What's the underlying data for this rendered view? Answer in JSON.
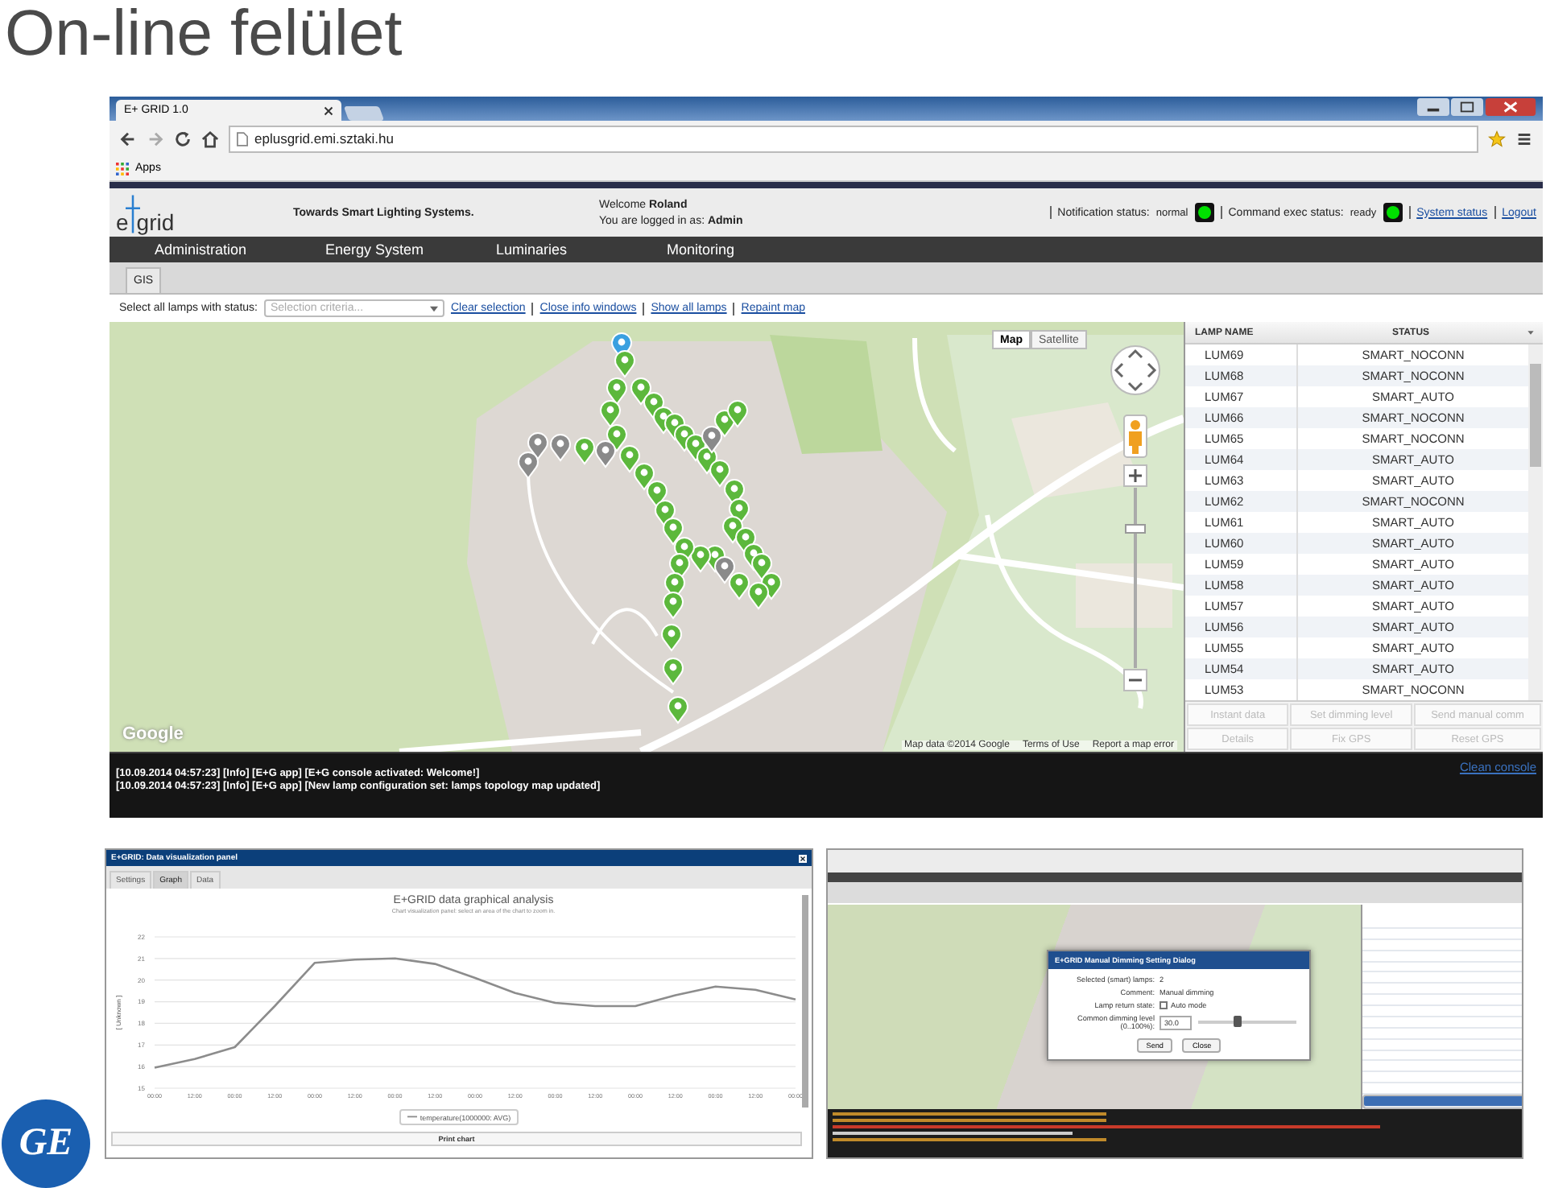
{
  "slide": {
    "title": "On-line felület"
  },
  "browser": {
    "tab": "E+ GRID 1.0",
    "url": "eplusgrid.emi.sztaki.hu",
    "bookmark": "Apps"
  },
  "app": {
    "logo": {
      "left": "e",
      "right": "grid"
    },
    "tagline": "Towards Smart Lighting Systems.",
    "welcome": "Welcome **Roland**",
    "login": "You are logged in as: **Admin**",
    "statuses": [
      {
        "label": "Notification status:",
        "value": "normal",
        "color": "#00e000"
      },
      {
        "label": "Command exec status:",
        "value": "ready",
        "color": "#00e000"
      }
    ],
    "links": [
      "System status",
      "Logout"
    ],
    "menu": [
      "Administration",
      "Energy System",
      "Luminaries",
      "Monitoring"
    ],
    "tabs": [
      {
        "label": "GIS",
        "selected": true
      }
    ],
    "filter": {
      "label": "Select all lamps with status:",
      "placeholder": "Selection criteria...",
      "links": [
        "Clear selection",
        "Close info windows",
        "Show all lamps",
        "Repaint map"
      ]
    },
    "map": {
      "types": [
        {
          "label": "Map",
          "selected": true
        },
        {
          "label": "Satellite",
          "selected": false
        }
      ],
      "logo": "Google",
      "footer": [
        "Map data ©2014 Google",
        "Terms of Use",
        "Report a map error"
      ]
    },
    "table": {
      "columns": [
        "LAMP NAME",
        "STATUS"
      ],
      "rows": [
        {
          "name": "LUM69",
          "status": "SMART_NOCONN"
        },
        {
          "name": "LUM68",
          "status": "SMART_NOCONN"
        },
        {
          "name": "LUM67",
          "status": "SMART_AUTO"
        },
        {
          "name": "LUM66",
          "status": "SMART_NOCONN"
        },
        {
          "name": "LUM65",
          "status": "SMART_NOCONN"
        },
        {
          "name": "LUM64",
          "status": "SMART_AUTO"
        },
        {
          "name": "LUM63",
          "status": "SMART_AUTO"
        },
        {
          "name": "LUM62",
          "status": "SMART_NOCONN"
        },
        {
          "name": "LUM61",
          "status": "SMART_AUTO"
        },
        {
          "name": "LUM60",
          "status": "SMART_AUTO"
        },
        {
          "name": "LUM59",
          "status": "SMART_AUTO"
        },
        {
          "name": "LUM58",
          "status": "SMART_AUTO"
        },
        {
          "name": "LUM57",
          "status": "SMART_AUTO"
        },
        {
          "name": "LUM56",
          "status": "SMART_AUTO"
        },
        {
          "name": "LUM55",
          "status": "SMART_AUTO"
        },
        {
          "name": "LUM54",
          "status": "SMART_AUTO"
        },
        {
          "name": "LUM53",
          "status": "SMART_NOCONN"
        }
      ],
      "buttons": [
        {
          "label": "Instant data",
          "disabled": true
        },
        {
          "label": "Set dimming level",
          "disabled": true
        },
        {
          "label": "Send manual comm",
          "disabled": true
        },
        {
          "label": "Details",
          "disabled": true
        },
        {
          "label": "Fix GPS",
          "disabled": true
        },
        {
          "label": "Reset GPS",
          "disabled": true
        }
      ]
    },
    "console": {
      "link": "Clean console",
      "lines": [
        "[10.09.2014 04:57:23] [Info] [E+G app] [E+G console activated: Welcome!]",
        "[10.09.2014 04:57:23] [Info] [E+G app] [New lamp configuration set: lamps topology map updated]"
      ]
    }
  },
  "chart_panel": {
    "title": "E+GRID: Data visualization panel",
    "tabs": [
      {
        "label": "Settings",
        "selected": false
      },
      {
        "label": "Graph",
        "selected": true
      },
      {
        "label": "Data",
        "selected": false
      }
    ],
    "subtitle": "Chart visualization panel: select an area of the chart to zoom in.",
    "button": "Print chart",
    "chart_data": {
      "type": "line",
      "title": "E+GRID data graphical analysis",
      "ylabel": "[ Unknown ]",
      "categories": [
        "00:00",
        "12:00",
        "00:00",
        "12:00",
        "00:00",
        "12:00",
        "00:00",
        "12:00",
        "00:00",
        "12:00",
        "00:00",
        "12:00",
        "00:00",
        "12:00",
        "00:00",
        "12:00",
        "00:00"
      ],
      "series": [
        {
          "name": "temperature(1000000: AVG)",
          "color": "#8c8c8c",
          "values": [
            15.95,
            16.35,
            16.9,
            18.8,
            20.8,
            20.95,
            21.0,
            20.75,
            20.1,
            19.4,
            18.95,
            18.8,
            18.8,
            19.3,
            19.7,
            19.55,
            19.1
          ]
        }
      ],
      "ylim": [
        15,
        22
      ],
      "grid": true,
      "yticks": [
        15,
        16,
        17,
        18,
        19,
        20,
        21,
        22
      ]
    }
  },
  "dialog_shot": {
    "title": "E+GRID Manual Dimming Setting Dialog",
    "fields": [
      {
        "label": "Selected (smart) lamps:",
        "value": "2"
      },
      {
        "label": "Comment:",
        "value": "Manual dimming"
      }
    ],
    "checkbox": {
      "label": "Lamp return state:",
      "text": "Auto mode",
      "checked": false
    },
    "slider": {
      "label": "Common dimming level (0..100%):",
      "value": "30.0",
      "level": 0.4
    },
    "buttons": [
      "Send",
      "Close"
    ]
  },
  "brand": {
    "logo": "GE"
  }
}
